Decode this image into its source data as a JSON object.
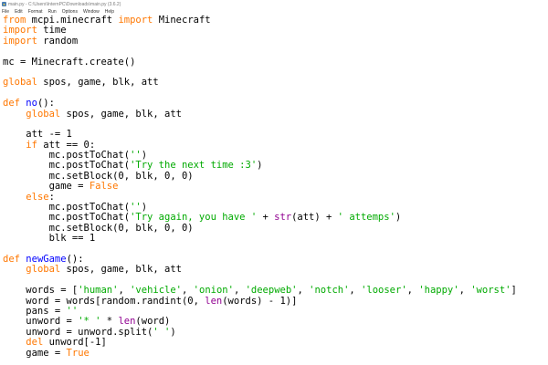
{
  "window": {
    "title": "main.py - C:\\Users\\InternPC\\Downloads\\main.py (3.6.2)"
  },
  "menu": {
    "items": [
      "File",
      "Edit",
      "Format",
      "Run",
      "Options",
      "Window",
      "Help"
    ]
  },
  "colors": {
    "keyword": "#ff7700",
    "string": "#00aa00",
    "definition": "#0000ff",
    "builtin": "#900090",
    "text": "#000000"
  },
  "code_lines": [
    [
      [
        "kw",
        "from"
      ],
      [
        "t",
        " mcpi.minecraft "
      ],
      [
        "kw",
        "import"
      ],
      [
        "t",
        " Minecraft"
      ]
    ],
    [
      [
        "kw",
        "import"
      ],
      [
        "t",
        " time"
      ]
    ],
    [
      [
        "kw",
        "import"
      ],
      [
        "t",
        " random"
      ]
    ],
    [],
    [
      [
        "t",
        "mc = Minecraft.create()"
      ]
    ],
    [],
    [
      [
        "kw",
        "global"
      ],
      [
        "t",
        " spos, game, blk, att"
      ]
    ],
    [],
    [
      [
        "kw",
        "def"
      ],
      [
        "t",
        " "
      ],
      [
        "def",
        "no"
      ],
      [
        "t",
        "():"
      ]
    ],
    [
      [
        "t",
        "    "
      ],
      [
        "kw",
        "global"
      ],
      [
        "t",
        " spos, game, blk, att"
      ]
    ],
    [],
    [
      [
        "t",
        "    att -= 1"
      ]
    ],
    [
      [
        "t",
        "    "
      ],
      [
        "kw",
        "if"
      ],
      [
        "t",
        " att == 0:"
      ]
    ],
    [
      [
        "t",
        "        mc.postToChat("
      ],
      [
        "str",
        "''"
      ],
      [
        "t",
        ")"
      ]
    ],
    [
      [
        "t",
        "        mc.postToChat("
      ],
      [
        "str",
        "'Try the next time :3'"
      ],
      [
        "t",
        ")"
      ]
    ],
    [
      [
        "t",
        "        mc.setBlock(0, blk, 0, 0)"
      ]
    ],
    [
      [
        "t",
        "        game = "
      ],
      [
        "kw",
        "False"
      ]
    ],
    [
      [
        "t",
        "    "
      ],
      [
        "kw",
        "else"
      ],
      [
        "t",
        ":"
      ]
    ],
    [
      [
        "t",
        "        mc.postToChat("
      ],
      [
        "str",
        "''"
      ],
      [
        "t",
        ")"
      ]
    ],
    [
      [
        "t",
        "        mc.postToChat("
      ],
      [
        "str",
        "'Try again, you have '"
      ],
      [
        "t",
        " + "
      ],
      [
        "bi",
        "str"
      ],
      [
        "t",
        "(att) + "
      ],
      [
        "str",
        "' attemps'"
      ],
      [
        "t",
        ")"
      ]
    ],
    [
      [
        "t",
        "        mc.setBlock(0, blk, 0, 0)"
      ]
    ],
    [
      [
        "t",
        "        blk == 1"
      ]
    ],
    [],
    [
      [
        "kw",
        "def"
      ],
      [
        "t",
        " "
      ],
      [
        "def",
        "newGame"
      ],
      [
        "t",
        "():"
      ]
    ],
    [
      [
        "t",
        "    "
      ],
      [
        "kw",
        "global"
      ],
      [
        "t",
        " spos, game, blk, att"
      ]
    ],
    [],
    [
      [
        "t",
        "    words = ["
      ],
      [
        "str",
        "'human'"
      ],
      [
        "t",
        ", "
      ],
      [
        "str",
        "'vehicle'"
      ],
      [
        "t",
        ", "
      ],
      [
        "str",
        "'onion'"
      ],
      [
        "t",
        ", "
      ],
      [
        "str",
        "'deepweb'"
      ],
      [
        "t",
        ", "
      ],
      [
        "str",
        "'notch'"
      ],
      [
        "t",
        ", "
      ],
      [
        "str",
        "'looser'"
      ],
      [
        "t",
        ", "
      ],
      [
        "str",
        "'happy'"
      ],
      [
        "t",
        ", "
      ],
      [
        "str",
        "'worst'"
      ],
      [
        "t",
        "]"
      ]
    ],
    [
      [
        "t",
        "    word = words[random.randint(0, "
      ],
      [
        "bi",
        "len"
      ],
      [
        "t",
        "(words) - 1)]"
      ]
    ],
    [
      [
        "t",
        "    pans = "
      ],
      [
        "str",
        "''"
      ]
    ],
    [
      [
        "t",
        "    unword = "
      ],
      [
        "str",
        "'* '"
      ],
      [
        "t",
        " * "
      ],
      [
        "bi",
        "len"
      ],
      [
        "t",
        "(word)"
      ]
    ],
    [
      [
        "t",
        "    unword = unword.split("
      ],
      [
        "str",
        "' '"
      ],
      [
        "t",
        ")"
      ]
    ],
    [
      [
        "t",
        "    "
      ],
      [
        "kw",
        "del"
      ],
      [
        "t",
        " unword[-1]"
      ]
    ],
    [
      [
        "t",
        "    game = "
      ],
      [
        "kw",
        "True"
      ]
    ]
  ]
}
